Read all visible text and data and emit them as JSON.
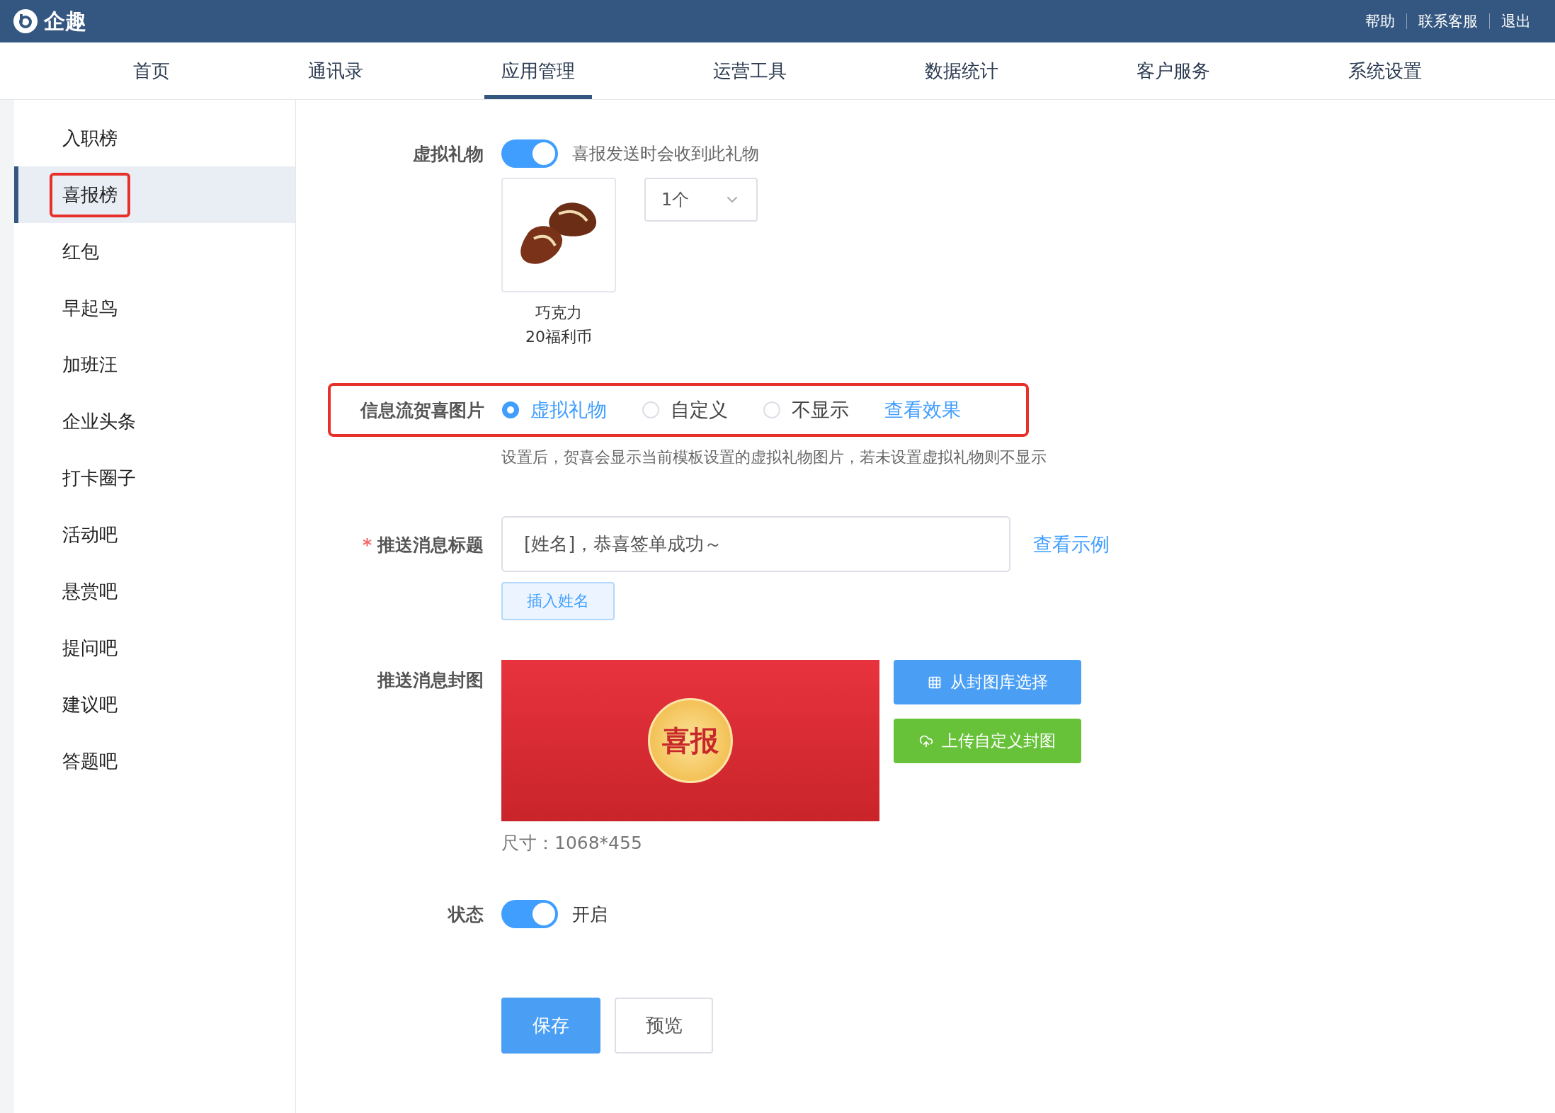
{
  "header": {
    "logo_text": "企趣",
    "links": [
      "帮助",
      "联系客服",
      "退出"
    ]
  },
  "nav": [
    {
      "label": "首页",
      "selected": false
    },
    {
      "label": "通讯录",
      "selected": false
    },
    {
      "label": "应用管理",
      "selected": true
    },
    {
      "label": "运营工具",
      "selected": false
    },
    {
      "label": "数据统计",
      "selected": false
    },
    {
      "label": "客户服务",
      "selected": false
    },
    {
      "label": "系统设置",
      "selected": false
    }
  ],
  "sidebar": [
    {
      "label": "入职榜",
      "selected": false,
      "highlighted": false
    },
    {
      "label": "喜报榜",
      "selected": true,
      "highlighted": true
    },
    {
      "label": "红包",
      "selected": false,
      "highlighted": false
    },
    {
      "label": "早起鸟",
      "selected": false,
      "highlighted": false
    },
    {
      "label": "加班汪",
      "selected": false,
      "highlighted": false
    },
    {
      "label": "企业头条",
      "selected": false,
      "highlighted": false
    },
    {
      "label": "打卡圈子",
      "selected": false,
      "highlighted": false
    },
    {
      "label": "活动吧",
      "selected": false,
      "highlighted": false
    },
    {
      "label": "悬赏吧",
      "selected": false,
      "highlighted": false
    },
    {
      "label": "提问吧",
      "selected": false,
      "highlighted": false
    },
    {
      "label": "建议吧",
      "selected": false,
      "highlighted": false
    },
    {
      "label": "答题吧",
      "selected": false,
      "highlighted": false
    }
  ],
  "gift": {
    "label": "虚拟礼物",
    "on": true,
    "hint": "喜报发送时会收到此礼物",
    "name": "巧克力",
    "price": "20福利币",
    "quantity": "1个"
  },
  "feed_image": {
    "label": "信息流贺喜图片",
    "highlighted": true,
    "options": [
      {
        "label": "虚拟礼物",
        "selected": true
      },
      {
        "label": "自定义",
        "selected": false
      },
      {
        "label": "不显示",
        "selected": false
      }
    ],
    "link": "查看效果",
    "hint": "设置后，贺喜会显示当前模板设置的虚拟礼物图片，若未设置虚拟礼物则不显示"
  },
  "push_title": {
    "label": "推送消息标题",
    "required_mark": "*",
    "value": "[姓名]，恭喜签单成功～",
    "link": "查看示例",
    "insert_button": "插入姓名"
  },
  "cover": {
    "label": "推送消息封图",
    "badge_text": "喜报",
    "buttons": [
      "从封图库选择",
      "上传自定义封图"
    ],
    "size": "尺寸：1068*455"
  },
  "status": {
    "label": "状态",
    "on": true,
    "text": "开启"
  },
  "actions": [
    "保存",
    "预览"
  ]
}
